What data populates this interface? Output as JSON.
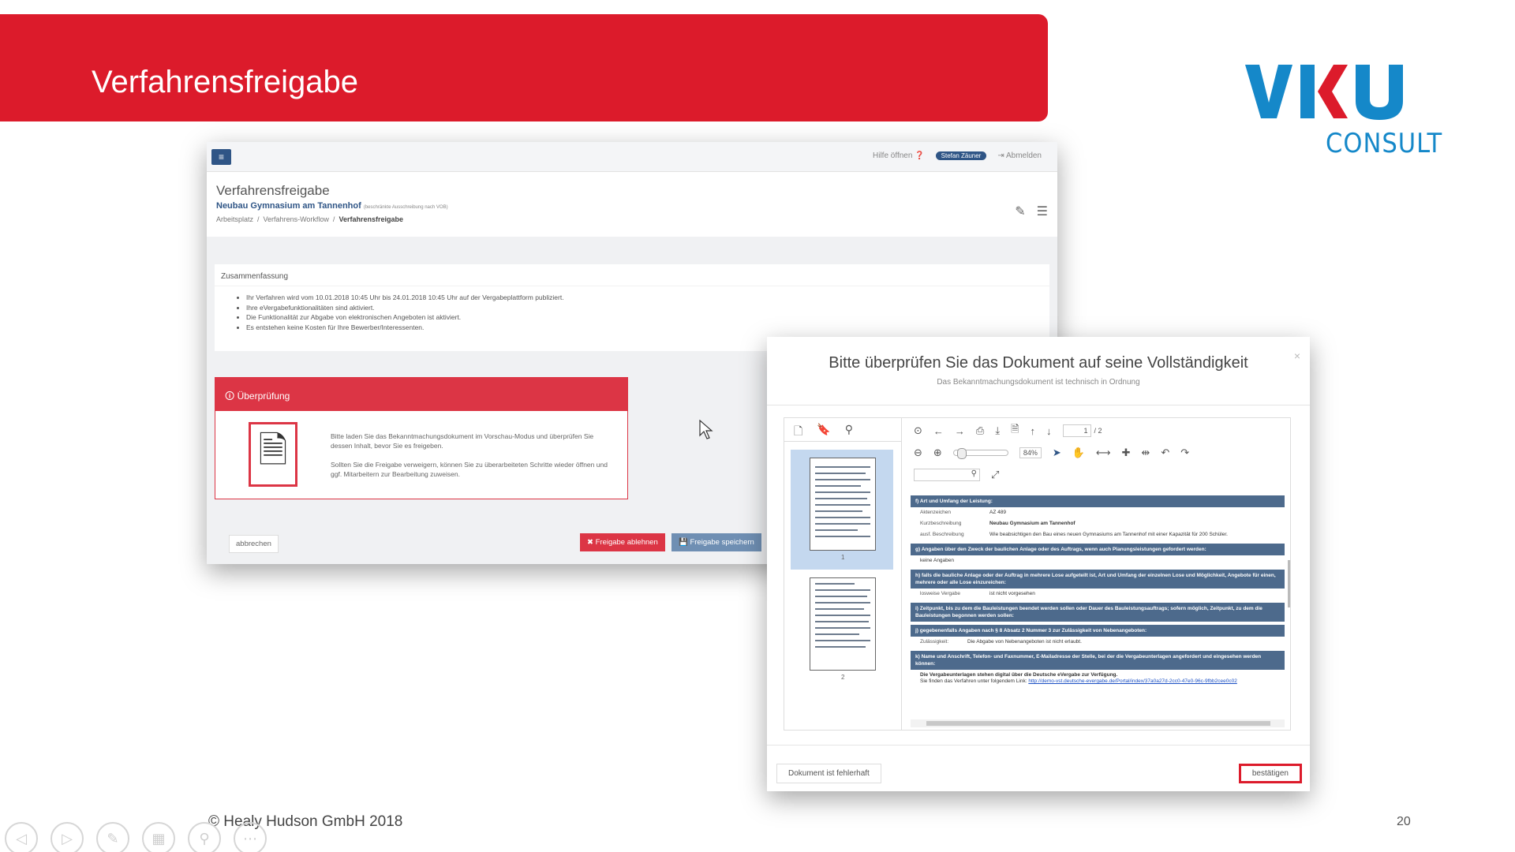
{
  "slide": {
    "title": "Verfahrensfreigabe",
    "copyright": "© Healy Hudson GmbH 2018",
    "page_number": "20",
    "brand_color": "#dc1b2b"
  },
  "logo": {
    "word": "VKU",
    "sub": "CONSULT",
    "color": "#1588c9",
    "accent_color": "#dc1b2b"
  },
  "app": {
    "menu_icon": "hamburger-icon",
    "help_label": "Hilfe öffnen",
    "user_name": "Stefan Zäuner",
    "logout_label": "Abmelden",
    "page_title": "Verfahrensfreigabe",
    "project_name": "Neubau Gymnasium am Tannenhof",
    "project_note": "(beschränkte Ausschreibung nach VOB)",
    "breadcrumb": [
      "Arbeitsplatz",
      "Verfahrens-Workflow",
      "Verfahrensfreigabe"
    ],
    "summary": {
      "title": "Zusammenfassung",
      "items": [
        "Ihr Verfahren wird vom 10.01.2018 10:45 Uhr bis 24.01.2018 10:45 Uhr auf der Vergabeplattform publiziert.",
        "Ihre eVergabefunktionalitäten sind aktiviert.",
        "Die Funktionalität zur Abgabe von elektronischen Angeboten ist aktiviert.",
        "Es entstehen keine Kosten für Ihre Bewerber/Interessenten."
      ]
    },
    "review": {
      "title": "Überprüfung",
      "text1": "Bitte laden Sie das Bekanntmachungsdokument im Vorschau-Modus und überprüfen Sie dessen Inhalt, bevor Sie es freigeben.",
      "text2": "Sollten Sie die Freigabe verweigern, können Sie zu überarbeiteten Schritte wieder öffnen und ggf. Mitarbeitern zur Bearbeitung zuweisen."
    },
    "buttons": {
      "cancel": "abbrechen",
      "reject": "✖ Freigabe ablehnen",
      "save": "💾 Freigabe speichern"
    }
  },
  "modal": {
    "title": "Bitte überprüfen Sie das Dokument auf seine Vollständigkeit",
    "subtitle": "Das Bekanntmachungsdokument ist technisch in Ordnung",
    "close": "×",
    "viewer": {
      "page": "1",
      "page_total": "/ 2",
      "zoom": "84%",
      "thumb1": "1",
      "thumb2": "2"
    },
    "doc": {
      "f_title": "f) Art und Umfang der Leistung:",
      "f_rows": [
        {
          "k": "Aktenzeichen",
          "v": "AZ 489"
        },
        {
          "k": "Kurzbeschreibung",
          "v": "Neubau Gymnasium am Tannenhof"
        },
        {
          "k": "ausf. Beschreibung",
          "v": "Wie beabsichtigen den Bau eines neuen Gymnasiums am Tannenhof mit einer Kapazität für 200 Schüler."
        }
      ],
      "g_title": "g) Angaben über den Zweck der baulichen Anlage oder des Auftrags, wenn auch Planungsleistungen gefordert werden:",
      "g_value": "keine Angaben",
      "h_title": "h) falls die bauliche Anlage oder der Auftrag in mehrere Lose aufgeteilt ist, Art und Umfang der einzelnen Lose und Möglichkeit, Angebote für einen, mehrere oder alle Lose einzureichen:",
      "h_row": {
        "k": "losweise Vergabe",
        "v": "ist nicht vorgesehen"
      },
      "i_title": "i) Zeitpunkt, bis zu dem die Bauleistungen beendet werden sollen oder Dauer des Bauleistungsauftrags; sofern möglich, Zeitpunkt, zu dem die Bauleistungen begonnen werden sollen:",
      "j_title": "j) gegebenenfalls Angaben nach § 8 Absatz 2 Nummer 3 zur Zulässigkeit von Nebenangeboten:",
      "j_row": {
        "k": "Zulässigkeit:",
        "v": "Die Abgabe von Nebenangeboten ist nicht erlaubt."
      },
      "k_title": "k) Name und Anschrift, Telefon- und Faxnummer, E-Mailadresse der Stelle, bei der die Vergabeunterlagen angefordert und eingesehen werden können:",
      "k_text1": "Die Vergabeunterlagen stehen digital über die Deutsche eVergabe zur Verfügung.",
      "k_text2": "Sie finden das Verfahren unter folgendem Link:",
      "k_link": "http://demo-vst.deutsche-evergabe.de/Portal/index/37a0a27d-2cc0-47e0-96c-9fbb2cee0c02"
    },
    "buttons": {
      "faulty": "Dokument ist fehlerhaft",
      "confirm": "bestätigen"
    }
  },
  "presenter_controls": [
    "back-icon",
    "forward-icon",
    "pen-icon",
    "slides-icon",
    "zoom-icon",
    "more-icon"
  ]
}
